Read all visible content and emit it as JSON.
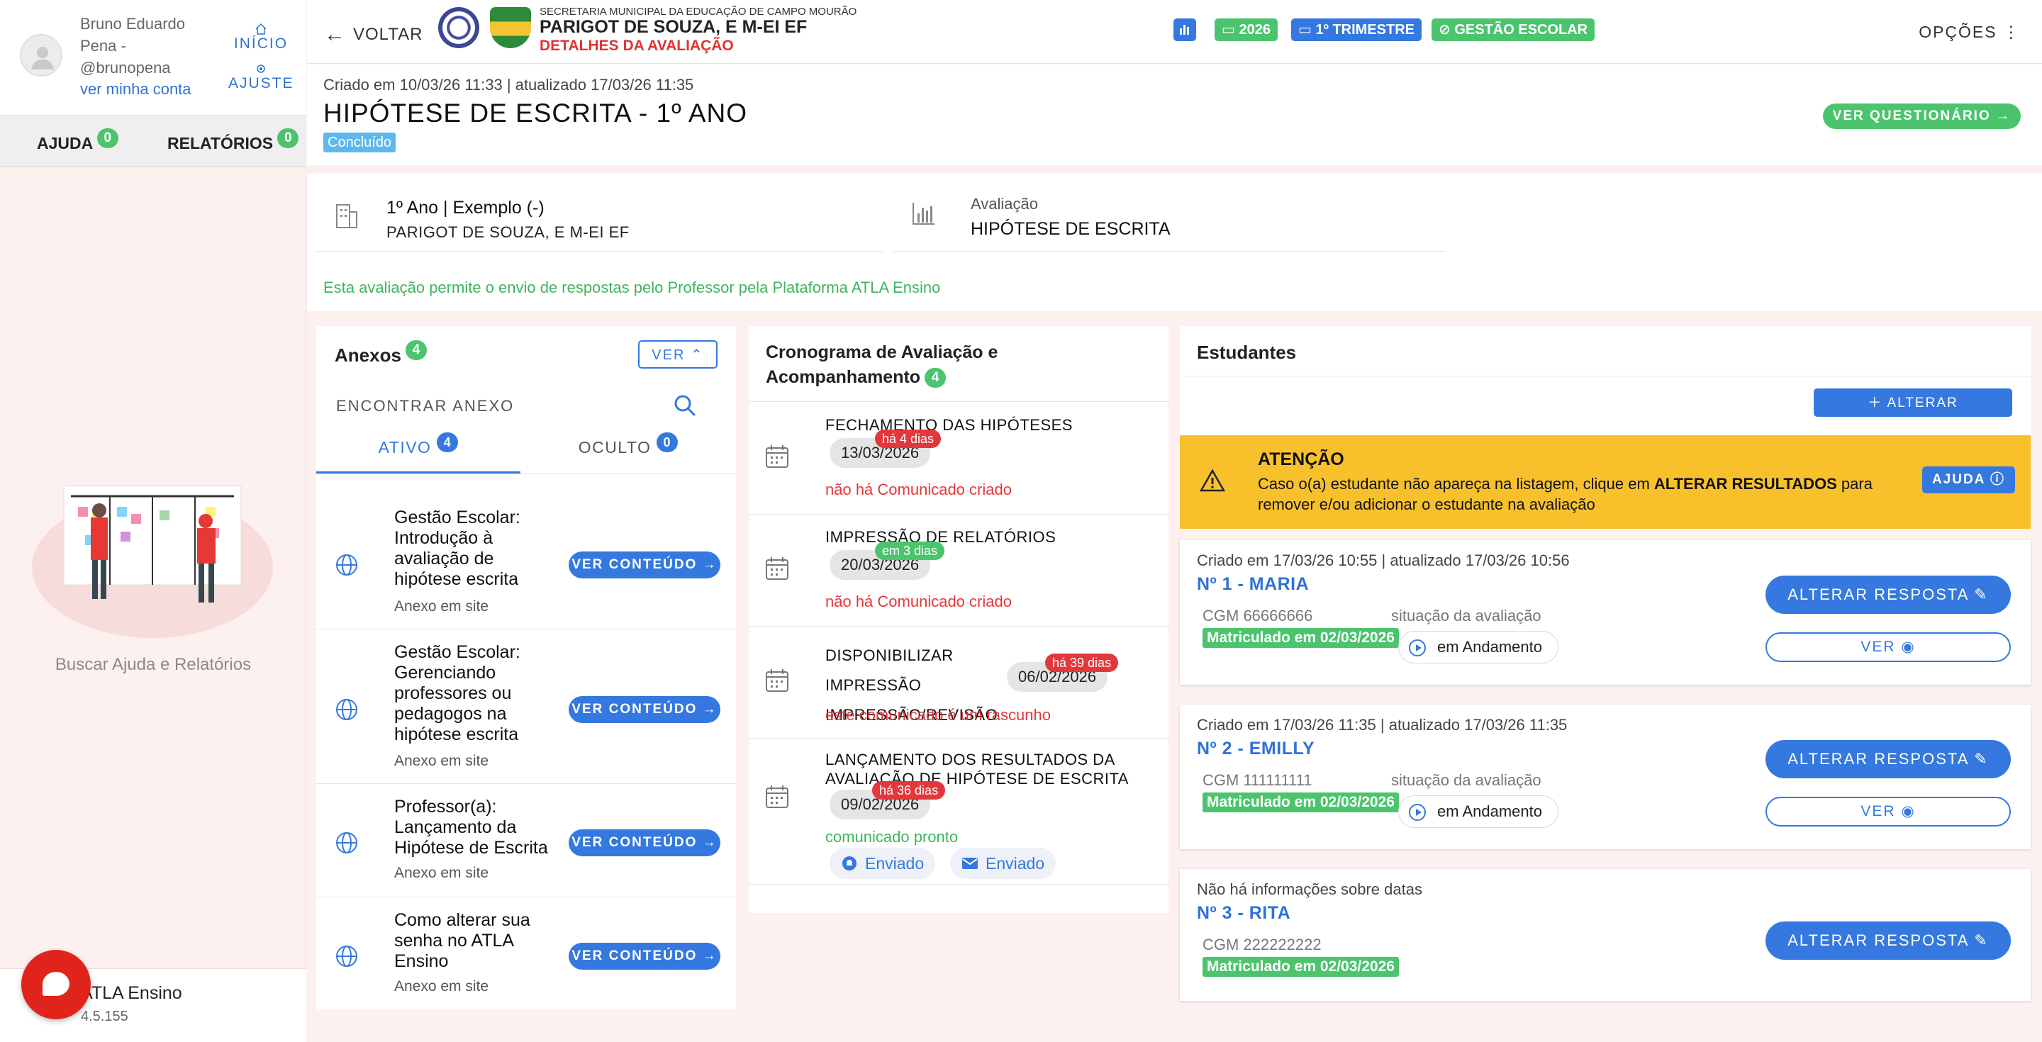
{
  "sidebar": {
    "user_name": "Bruno Eduardo Pena - @brunopena",
    "account_link": "ver minha conta",
    "nav_home": "INÍCIO",
    "nav_settings": "AJUSTE",
    "tab_help": "AJUDA",
    "tab_help_count": "0",
    "tab_reports": "RELATÓRIOS",
    "tab_reports_count": "0",
    "help_caption": "Buscar Ajuda e Relatórios",
    "app_name": "ATLA Ensino",
    "app_version": "4.5.155"
  },
  "header": {
    "back_label": "VOLTAR",
    "secretaria": "SECRETARIA MUNICIPAL DA EDUCAÇÃO DE CAMPO MOURÃO",
    "school": "PARIGOT DE SOUZA, E M-EI EF",
    "subtitle": "DETALHES DA AVALIAÇÃO",
    "chip_year": "2026",
    "chip_period": "1º TRIMESTRE",
    "chip_module": "GESTÃO ESCOLAR",
    "options_label": "OPÇÕES"
  },
  "evaluation": {
    "meta": "Criado em 10/03/26 11:33 | atualizado 17/03/26 11:35",
    "title": "HIPÓTESE DE ESCRITA - 1º ANO",
    "status": "Concluído",
    "questionnaire_button": "VER QUESTIONÁRIO",
    "class_line1": "1º Ano | Exemplo (-)",
    "class_line2": "PARIGOT DE SOUZA, E M-EI EF",
    "eval_label": "Avaliação",
    "eval_value": "HIPÓTESE DE ESCRITA",
    "permission_note": "Esta avaliação permite o envio de respostas pelo Professor pela Plataforma ATLA Ensino"
  },
  "annexes": {
    "title": "Anexos",
    "count": "4",
    "toggle_label": "VER",
    "search_placeholder": "ENCONTRAR ANEXO",
    "tab_active": "ATIVO",
    "tab_active_count": "4",
    "tab_hidden": "OCULTO",
    "tab_hidden_count": "0",
    "items": [
      {
        "title": "Gestão Escolar: Introdução à avaliação de hipótese escrita",
        "subtitle": "Anexo em site",
        "button": "VER CONTEÚDO"
      },
      {
        "title": "Gestão Escolar: Gerenciando professores ou pedagogos na hipótese escrita",
        "subtitle": "Anexo em site",
        "button": "VER CONTEÚDO"
      },
      {
        "title": "Professor(a): Lançamento da Hipótese de Escrita",
        "subtitle": "Anexo em site",
        "button": "VER CONTEÚDO"
      },
      {
        "title": "Como alterar sua senha no ATLA Ensino",
        "subtitle": "Anexo em site",
        "button": "VER CONTEÚDO"
      }
    ]
  },
  "schedule": {
    "title": "Cronograma de Avaliação e Acompanhamento",
    "count": "4",
    "items": [
      {
        "title": "FECHAMENTO DAS HIPÓTESES",
        "date": "13/03/2026",
        "tag": "há 4 dias",
        "note": "não há Comunicado criado"
      },
      {
        "title": "IMPRESSÃO DE RELATÓRIOS",
        "date": "20/03/2026",
        "tag": "em 3 dias",
        "note": "não há Comunicado criado"
      },
      {
        "title": "DISPONIBILIZAR IMPRESSÃO IMPRESSÃO/REVISÃO",
        "date": "06/02/2026",
        "tag": "há 39 dias",
        "note": "este comunicado é um rascunho"
      },
      {
        "title": "LANÇAMENTO DOS RESULTADOS DA AVALIAÇÃO DE HIPÓTESE DE ESCRITA",
        "date": "09/02/2026",
        "tag": "há 36 dias",
        "note": "comunicado pronto",
        "sent_app": "Enviado",
        "sent_email": "Enviado"
      }
    ]
  },
  "students": {
    "title": "Estudantes",
    "change_results_button": "ALTERAR RESULTADOS",
    "attention_title": "ATENÇÃO",
    "attention_text_1": "Caso o(a) estudante não apareça na listagem, clique em ",
    "attention_text_bold": "ALTERAR RESULTADOS",
    "attention_text_2": " para remover e/ou adicionar o estudante na avaliação",
    "help_button": "AJUDA",
    "items": [
      {
        "meta": "Criado em 17/03/26 10:55 | atualizado 17/03/26 10:56",
        "name": "Nº 1 - MARIA",
        "cgm": "CGM 66666666",
        "situation_label": "situação da avaliação",
        "enrollment": "Matriculado em 02/03/2026",
        "progress": "em Andamento",
        "change_button": "ALTERAR RESPOSTA",
        "view_button": "VER"
      },
      {
        "meta": "Criado em 17/03/26 11:35 | atualizado 17/03/26 11:35",
        "name": "Nº 2 - EMILLY",
        "cgm": "CGM 111111111",
        "situation_label": "situação da avaliação",
        "enrollment": "Matriculado em 02/03/2026",
        "progress": "em Andamento",
        "change_button": "ALTERAR RESPOSTA",
        "view_button": "VER"
      },
      {
        "meta": "Não há informações sobre datas",
        "name": "Nº 3 - RITA",
        "cgm": "CGM 222222222",
        "enrollment": "Matriculado em 02/03/2026",
        "change_button": "ALTERAR RESPOSTA"
      }
    ]
  },
  "colors": {
    "accent": "#3478e0",
    "success": "#4cc46d",
    "danger": "#e2383c",
    "warning": "#f8c12c"
  }
}
